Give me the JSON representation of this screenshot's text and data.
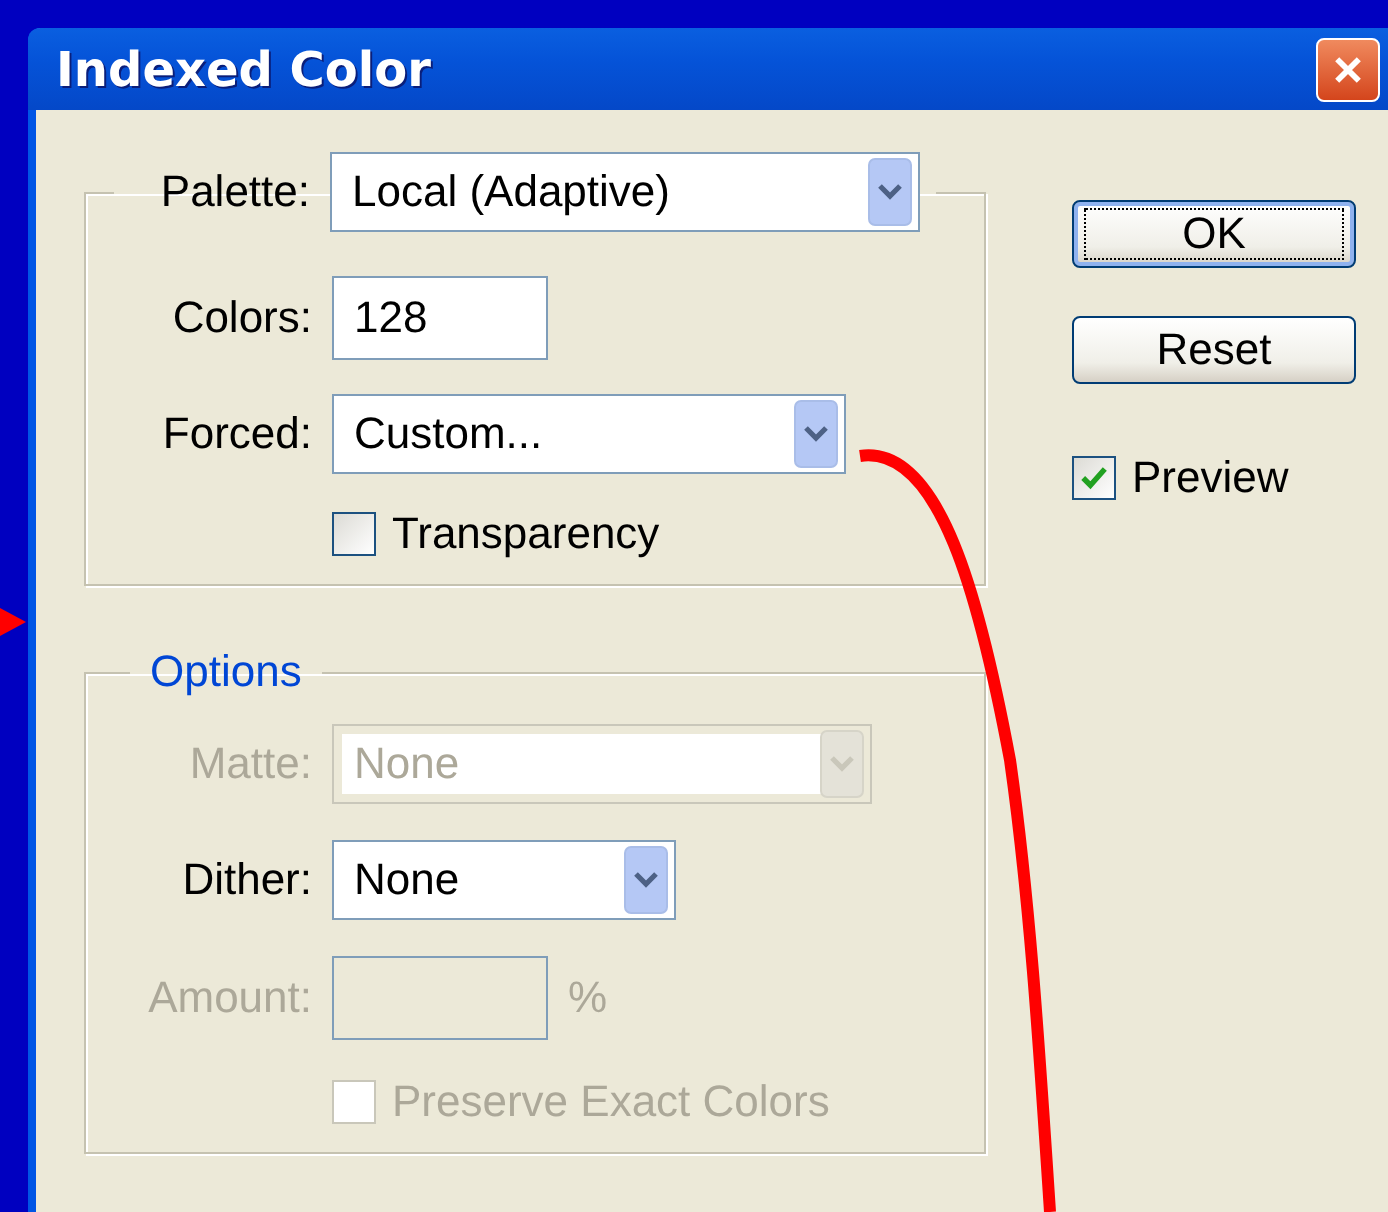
{
  "window": {
    "title": "Indexed Color"
  },
  "palette_group": {
    "header": {
      "kind": "dropdown",
      "label": "Palette:",
      "value": "Local (Adaptive)",
      "disabled": false
    },
    "rows": [
      {
        "kind": "text",
        "label": "Colors:",
        "value": "128",
        "disabled": false
      },
      {
        "kind": "dropdown",
        "label": "Forced:",
        "value": "Custom...",
        "disabled": false
      },
      {
        "kind": "checkbox",
        "label": "Transparency",
        "checked": false,
        "disabled": false
      }
    ]
  },
  "options_group": {
    "title": "Options",
    "rows": [
      {
        "kind": "dropdown",
        "label": "Matte:",
        "value": "None",
        "disabled": true
      },
      {
        "kind": "dropdown",
        "label": "Dither:",
        "value": "None",
        "disabled": false
      },
      {
        "kind": "text",
        "label": "Amount:",
        "value": "",
        "unit": "%",
        "disabled": true
      },
      {
        "kind": "checkbox",
        "label": "Preserve Exact Colors",
        "checked": false,
        "disabled": true
      }
    ]
  },
  "buttons": [
    {
      "label": "OK",
      "default": true
    },
    {
      "label": "Reset",
      "default": false
    }
  ],
  "preview": {
    "label": "Preview",
    "checked": true
  }
}
